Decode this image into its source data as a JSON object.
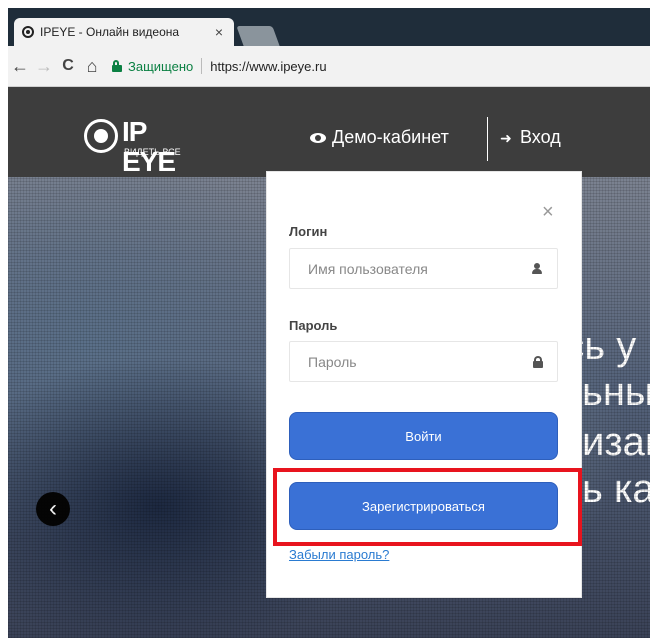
{
  "browser": {
    "tab_title": "IPEYE - Онлайн видеона",
    "tab_close": "×",
    "back_icon": "←",
    "forward_icon": "→",
    "reload_icon": "C",
    "home_icon": "⌂",
    "secure_label": "Защищено",
    "url": "https://www.ipeye.ru"
  },
  "header": {
    "logo_text": "IP EYE",
    "logo_tagline": "ВИДЕТЬ ВСЕ",
    "demo_label": "Демо-кабинет",
    "login_label": "Вход",
    "login_icon": "➜"
  },
  "hero": {
    "line1": "есь у",
    "line2": "ьны",
    "line3": "изац",
    "line4": "ь ка",
    "prev_icon": "‹"
  },
  "login_popup": {
    "close_icon": "×",
    "login_label": "Логин",
    "login_placeholder": "Имя пользователя",
    "password_label": "Пароль",
    "password_placeholder": "Пароль",
    "submit_label": "Войти",
    "register_label": "Зарегистрироваться",
    "forgot_label": "Забыли пароль?"
  },
  "colors": {
    "primary_button": "#3a71d6",
    "highlight": "#e8141e",
    "secure_green": "#0b8043",
    "link": "#2a7bd1"
  }
}
